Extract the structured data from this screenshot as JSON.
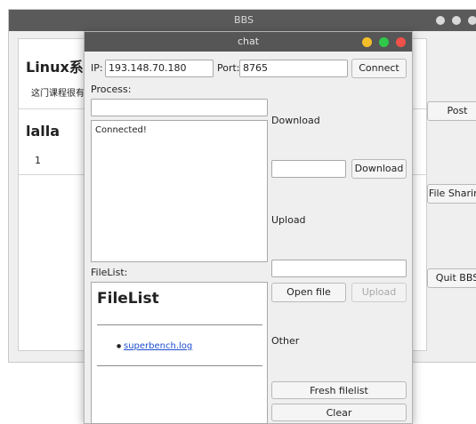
{
  "bbs": {
    "title": "BBS",
    "heading": "Linux系统",
    "description": "这门课程很有趣",
    "post_title": "lalla",
    "post_body": "1",
    "buttons": {
      "post": "Post",
      "file_sharing": "File Sharing",
      "quit": "Quit BBS"
    }
  },
  "chat": {
    "title": "chat",
    "ip_label": "IP:",
    "ip_value": "193.148.70.180",
    "port_label": "Port:",
    "port_value": "8765",
    "connect_label": "Connect",
    "process_label": "Process:",
    "process_value": "",
    "log_text": "Connected!",
    "download_section": "Download",
    "download_value": "",
    "download_button": "Download",
    "upload_section": "Upload",
    "upload_value": "",
    "open_file_button": "Open file",
    "upload_button": "Upload",
    "other_section": "Other",
    "fresh_button": "Fresh filelist",
    "clear_button": "Clear",
    "filelist_label": "FileList:",
    "filelist": {
      "heading": "FileList",
      "items": [
        "superbench.log"
      ]
    }
  },
  "colors": {
    "titlebar": "#565656",
    "window_bg": "#efefef",
    "dot_yellow": "#f5bf2a",
    "dot_green": "#2fc84a",
    "dot_red": "#f0524a",
    "link": "#1f4fd1"
  }
}
